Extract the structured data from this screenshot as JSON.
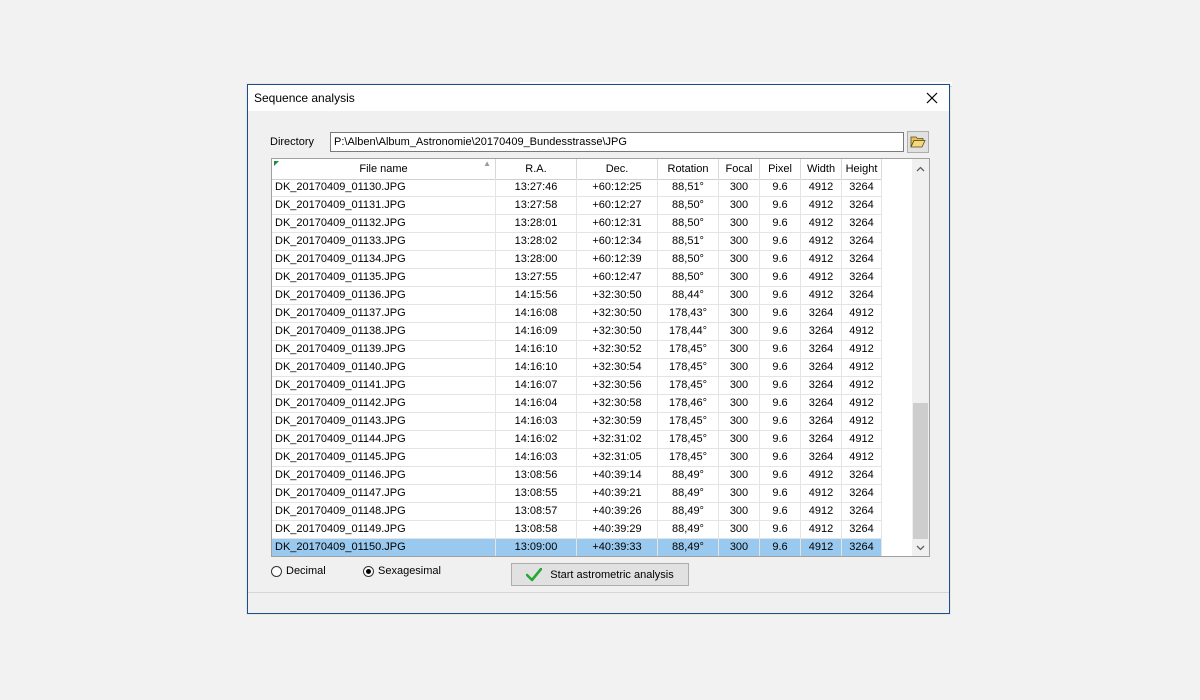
{
  "dialog": {
    "title": "Sequence analysis"
  },
  "directory": {
    "label": "Directory",
    "value": "P:\\Alben\\Album_Astronomie\\20170409_Bundesstrasse\\JPG"
  },
  "table": {
    "columns": [
      "File name",
      "R.A.",
      "Dec.",
      "Rotation",
      "Focal",
      "Pixel",
      "Width",
      "Height"
    ],
    "rows": [
      [
        "DK_20170409_01130.JPG",
        "13:27:46",
        "+60:12:25",
        "88,51°",
        "300",
        "9.6",
        "4912",
        "3264"
      ],
      [
        "DK_20170409_01131.JPG",
        "13:27:58",
        "+60:12:27",
        "88,50°",
        "300",
        "9.6",
        "4912",
        "3264"
      ],
      [
        "DK_20170409_01132.JPG",
        "13:28:01",
        "+60:12:31",
        "88,50°",
        "300",
        "9.6",
        "4912",
        "3264"
      ],
      [
        "DK_20170409_01133.JPG",
        "13:28:02",
        "+60:12:34",
        "88,51°",
        "300",
        "9.6",
        "4912",
        "3264"
      ],
      [
        "DK_20170409_01134.JPG",
        "13:28:00",
        "+60:12:39",
        "88,50°",
        "300",
        "9.6",
        "4912",
        "3264"
      ],
      [
        "DK_20170409_01135.JPG",
        "13:27:55",
        "+60:12:47",
        "88,50°",
        "300",
        "9.6",
        "4912",
        "3264"
      ],
      [
        "DK_20170409_01136.JPG",
        "14:15:56",
        "+32:30:50",
        "88,44°",
        "300",
        "9.6",
        "4912",
        "3264"
      ],
      [
        "DK_20170409_01137.JPG",
        "14:16:08",
        "+32:30:50",
        "178,43°",
        "300",
        "9.6",
        "3264",
        "4912"
      ],
      [
        "DK_20170409_01138.JPG",
        "14:16:09",
        "+32:30:50",
        "178,44°",
        "300",
        "9.6",
        "3264",
        "4912"
      ],
      [
        "DK_20170409_01139.JPG",
        "14:16:10",
        "+32:30:52",
        "178,45°",
        "300",
        "9.6",
        "3264",
        "4912"
      ],
      [
        "DK_20170409_01140.JPG",
        "14:16:10",
        "+32:30:54",
        "178,45°",
        "300",
        "9.6",
        "3264",
        "4912"
      ],
      [
        "DK_20170409_01141.JPG",
        "14:16:07",
        "+32:30:56",
        "178,45°",
        "300",
        "9.6",
        "3264",
        "4912"
      ],
      [
        "DK_20170409_01142.JPG",
        "14:16:04",
        "+32:30:58",
        "178,46°",
        "300",
        "9.6",
        "3264",
        "4912"
      ],
      [
        "DK_20170409_01143.JPG",
        "14:16:03",
        "+32:30:59",
        "178,45°",
        "300",
        "9.6",
        "3264",
        "4912"
      ],
      [
        "DK_20170409_01144.JPG",
        "14:16:02",
        "+32:31:02",
        "178,45°",
        "300",
        "9.6",
        "3264",
        "4912"
      ],
      [
        "DK_20170409_01145.JPG",
        "14:16:03",
        "+32:31:05",
        "178,45°",
        "300",
        "9.6",
        "3264",
        "4912"
      ],
      [
        "DK_20170409_01146.JPG",
        "13:08:56",
        "+40:39:14",
        "88,49°",
        "300",
        "9.6",
        "4912",
        "3264"
      ],
      [
        "DK_20170409_01147.JPG",
        "13:08:55",
        "+40:39:21",
        "88,49°",
        "300",
        "9.6",
        "4912",
        "3264"
      ],
      [
        "DK_20170409_01148.JPG",
        "13:08:57",
        "+40:39:26",
        "88,49°",
        "300",
        "9.6",
        "4912",
        "3264"
      ],
      [
        "DK_20170409_01149.JPG",
        "13:08:58",
        "+40:39:29",
        "88,49°",
        "300",
        "9.6",
        "4912",
        "3264"
      ],
      [
        "DK_20170409_01150.JPG",
        "13:09:00",
        "+40:39:33",
        "88,49°",
        "300",
        "9.6",
        "4912",
        "3264"
      ]
    ],
    "selected_index": 20
  },
  "format": {
    "decimal_label": "Decimal",
    "sexagesimal_label": "Sexagesimal",
    "selected": "sexagesimal"
  },
  "actions": {
    "start_label": "Start astrometric analysis"
  },
  "colors": {
    "selection": "#99c9ef",
    "check": "#22aa33",
    "border_accent": "#1b4f8a"
  },
  "icons": {
    "close": "close-icon",
    "folder": "folder-open-icon",
    "check": "checkmark-icon",
    "scroll_up": "chevron-up-icon",
    "scroll_down": "chevron-down-icon"
  }
}
